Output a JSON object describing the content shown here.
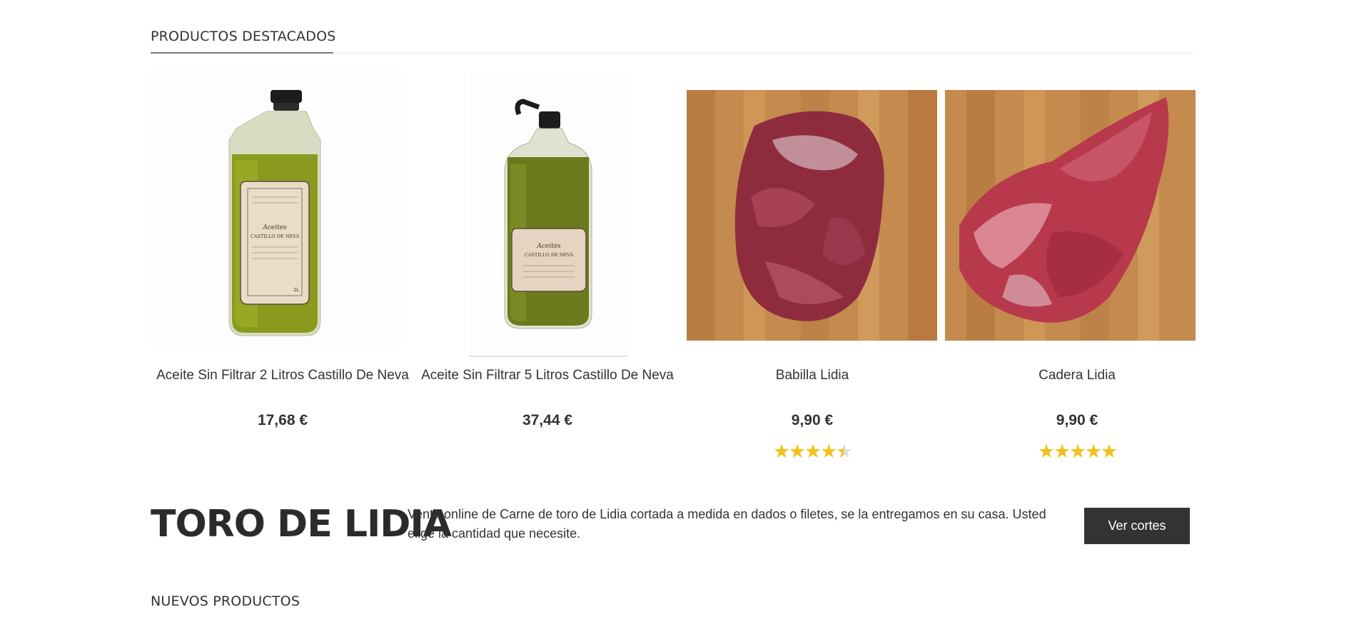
{
  "featured": {
    "heading": "PRODUCTOS DESTACADOS",
    "products": [
      {
        "name": "Aceite Sin Filtrar 2 Litros Castillo De Neva",
        "price": "17,68 €",
        "image": "olive-oil-2l-bottle",
        "label_brand": "Aceites",
        "label_line": "CASTILLO DE NEVA",
        "volume": "2L"
      },
      {
        "name": "Aceite Sin Filtrar 5 Litros Castillo De Neva",
        "price": "37,44 €",
        "image": "olive-oil-5l-jug",
        "label_brand": "Aceites",
        "label_line": "CASTILLO DE NEVA"
      },
      {
        "name": "Babilla Lidia",
        "price": "9,90 €",
        "image": "raw-beef-round-on-board",
        "rating": 4.5
      },
      {
        "name": "Cadera Lidia",
        "price": "9,90 €",
        "image": "raw-beef-rump-on-board",
        "rating": 5
      }
    ]
  },
  "banner": {
    "title": "TORO DE LIDIA",
    "text": "Venta online de Carne de toro de Lidia cortada a medida en dados o filetes, se la entregamos en su casa. Usted elige la cantidad que necesite.",
    "button_label": "Ver cortes"
  },
  "new_products": {
    "heading": "NUEVOS PRODUCTOS"
  },
  "colors": {
    "star_filled": "#f2c21b",
    "star_empty": "#dddddd",
    "button_bg": "#333333",
    "text": "#333333"
  }
}
